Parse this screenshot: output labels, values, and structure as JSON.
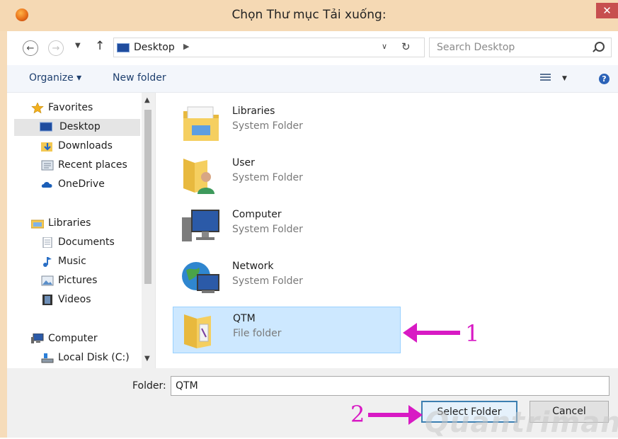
{
  "window": {
    "title": "Chọn Thư mục Tải xuống:",
    "close_glyph": "✕"
  },
  "nav": {
    "back_glyph": "←",
    "forward_glyph": "→",
    "history_glyph": "▼",
    "up_glyph": "↑",
    "address": "Desktop",
    "address_sep": "▶",
    "address_drop": "∨",
    "refresh_glyph": "↻",
    "search_placeholder": "Search Desktop"
  },
  "toolbar": {
    "organize": "Organize ▾",
    "new_folder": "New folder",
    "view_drop": "▼",
    "help": "?"
  },
  "sidebar": {
    "favorites": "Favorites",
    "desktop": "Desktop",
    "downloads": "Downloads",
    "recent": "Recent places",
    "onedrive": "OneDrive",
    "libraries": "Libraries",
    "documents": "Documents",
    "music": "Music",
    "pictures": "Pictures",
    "videos": "Videos",
    "computer": "Computer",
    "local_disk": "Local Disk (C:)",
    "scroll_up": "▲",
    "scroll_down": "▼"
  },
  "items": [
    {
      "name": "Libraries",
      "type": "System Folder"
    },
    {
      "name": "User",
      "type": "System Folder"
    },
    {
      "name": "Computer",
      "type": "System Folder"
    },
    {
      "name": "Network",
      "type": "System Folder"
    },
    {
      "name": "QTM",
      "type": "File folder"
    }
  ],
  "bottom": {
    "folder_label": "Folder:",
    "folder_value": "QTM",
    "select_label": "Select Folder",
    "cancel_label": "Cancel"
  },
  "annotations": {
    "num1": "1",
    "num2": "2",
    "watermark": "Quantrimang"
  },
  "colors": {
    "accent": "#d81ac4",
    "titlebar": "#f5d9b4",
    "selection": "#cde8ff"
  }
}
